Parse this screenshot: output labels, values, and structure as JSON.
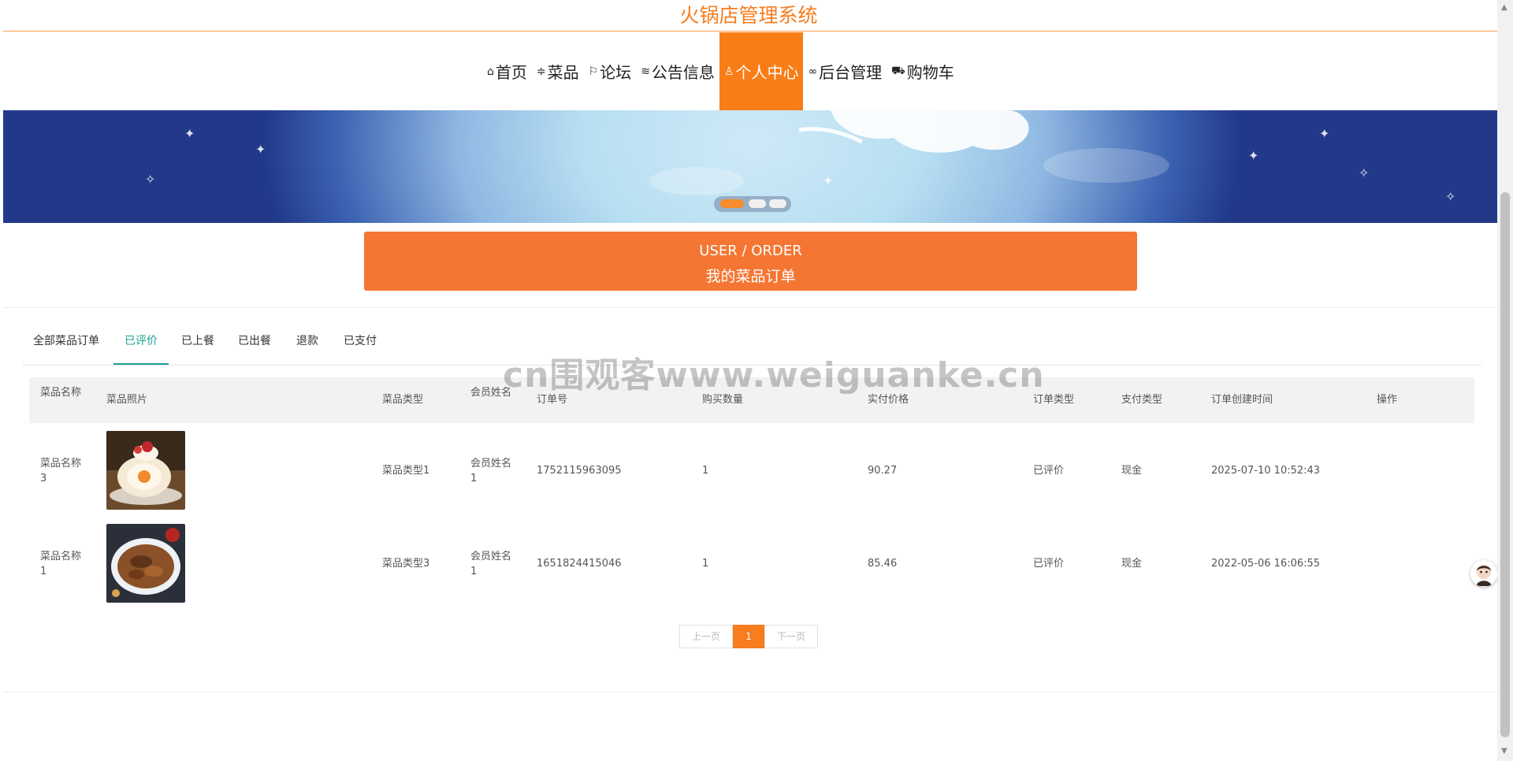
{
  "site": {
    "title": "火锅店管理系统"
  },
  "nav": {
    "items": [
      {
        "label": "首页",
        "icon": "home-icon"
      },
      {
        "label": "菜品",
        "icon": "sliders-icon"
      },
      {
        "label": "论坛",
        "icon": "flag-icon"
      },
      {
        "label": "公告信息",
        "icon": "layers-icon"
      },
      {
        "label": "个人中心",
        "icon": "user-icon",
        "active": true
      },
      {
        "label": "后台管理",
        "icon": "link-icon"
      },
      {
        "label": "购物车",
        "icon": "cart-icon"
      }
    ]
  },
  "banner": {
    "slides": 3,
    "active_slide": 1
  },
  "order_header": {
    "en": "USER / ORDER",
    "cn": "我的菜品订单"
  },
  "tabs": [
    {
      "label": "全部菜品订单"
    },
    {
      "label": "已评价",
      "active": true
    },
    {
      "label": "已上餐"
    },
    {
      "label": "已出餐"
    },
    {
      "label": "退款"
    },
    {
      "label": "已支付"
    }
  ],
  "table": {
    "headers": [
      "菜品名称",
      "菜品照片",
      "菜品类型",
      "会员姓名",
      "订单号",
      "购买数量",
      "实付价格",
      "订单类型",
      "支付类型",
      "订单创建时间",
      "操作"
    ],
    "rows": [
      {
        "name": "菜品名称3",
        "photo": "cake-roll-photo",
        "type": "菜品类型1",
        "member": "会员姓名1",
        "order_no": "1752115963095",
        "qty": "1",
        "price": "90.27",
        "order_type": "已评价",
        "pay_type": "现金",
        "created": "2025-07-10 10:52:43",
        "action": ""
      },
      {
        "name": "菜品名称1",
        "photo": "beef-noodle-photo",
        "type": "菜品类型3",
        "member": "会员姓名1",
        "order_no": "1651824415046",
        "qty": "1",
        "price": "85.46",
        "order_type": "已评价",
        "pay_type": "现金",
        "created": "2022-05-06 16:06:55",
        "action": ""
      }
    ]
  },
  "pagination": {
    "prev": "上一页",
    "current": "1",
    "next": "下一页"
  },
  "watermark": "cn围观客www.weiguanke.cn",
  "colors": {
    "accent": "#f77d1f",
    "order_banner": "#f47632",
    "tab_active": "#1aa094"
  }
}
